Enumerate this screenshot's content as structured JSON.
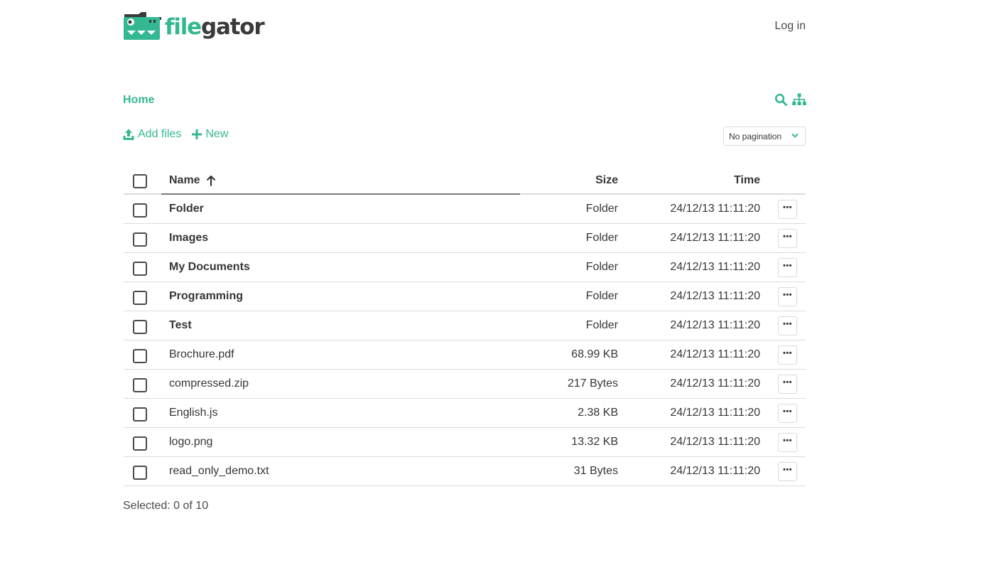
{
  "header": {
    "logo_text_part1": "file",
    "logo_text_part2": "gator",
    "login_label": "Log in"
  },
  "breadcrumb": {
    "home_label": "Home"
  },
  "tools": {
    "icons": [
      "search-icon",
      "sitemap-icon"
    ]
  },
  "actions": {
    "add_files_label": "Add files",
    "new_label": "New"
  },
  "pagination": {
    "selected": "No pagination"
  },
  "table": {
    "columns": {
      "name": "Name",
      "size": "Size",
      "time": "Time"
    },
    "sort": {
      "column": "Name",
      "direction": "ascending"
    },
    "rows": [
      {
        "name": "Folder",
        "size": "Folder",
        "time": "24/12/13 11:11:20",
        "type": "folder"
      },
      {
        "name": "Images",
        "size": "Folder",
        "time": "24/12/13 11:11:20",
        "type": "folder"
      },
      {
        "name": "My Documents",
        "size": "Folder",
        "time": "24/12/13 11:11:20",
        "type": "folder"
      },
      {
        "name": "Programming",
        "size": "Folder",
        "time": "24/12/13 11:11:20",
        "type": "folder"
      },
      {
        "name": "Test",
        "size": "Folder",
        "time": "24/12/13 11:11:20",
        "type": "folder"
      },
      {
        "name": "Brochure.pdf",
        "size": "68.99 KB",
        "time": "24/12/13 11:11:20",
        "type": "file"
      },
      {
        "name": "compressed.zip",
        "size": "217 Bytes",
        "time": "24/12/13 11:11:20",
        "type": "file"
      },
      {
        "name": "English.js",
        "size": "2.38 KB",
        "time": "24/12/13 11:11:20",
        "type": "file"
      },
      {
        "name": "logo.png",
        "size": "13.32 KB",
        "time": "24/12/13 11:11:20",
        "type": "file"
      },
      {
        "name": "read_only_demo.txt",
        "size": "31 Bytes",
        "time": "24/12/13 11:11:20",
        "type": "file"
      }
    ]
  },
  "footer": {
    "selected_text": "Selected: 0 of 10"
  },
  "colors": {
    "accent": "#34b891",
    "text": "#363636",
    "border": "#dbdbdb",
    "logo_dark": "#3a3a3a"
  }
}
